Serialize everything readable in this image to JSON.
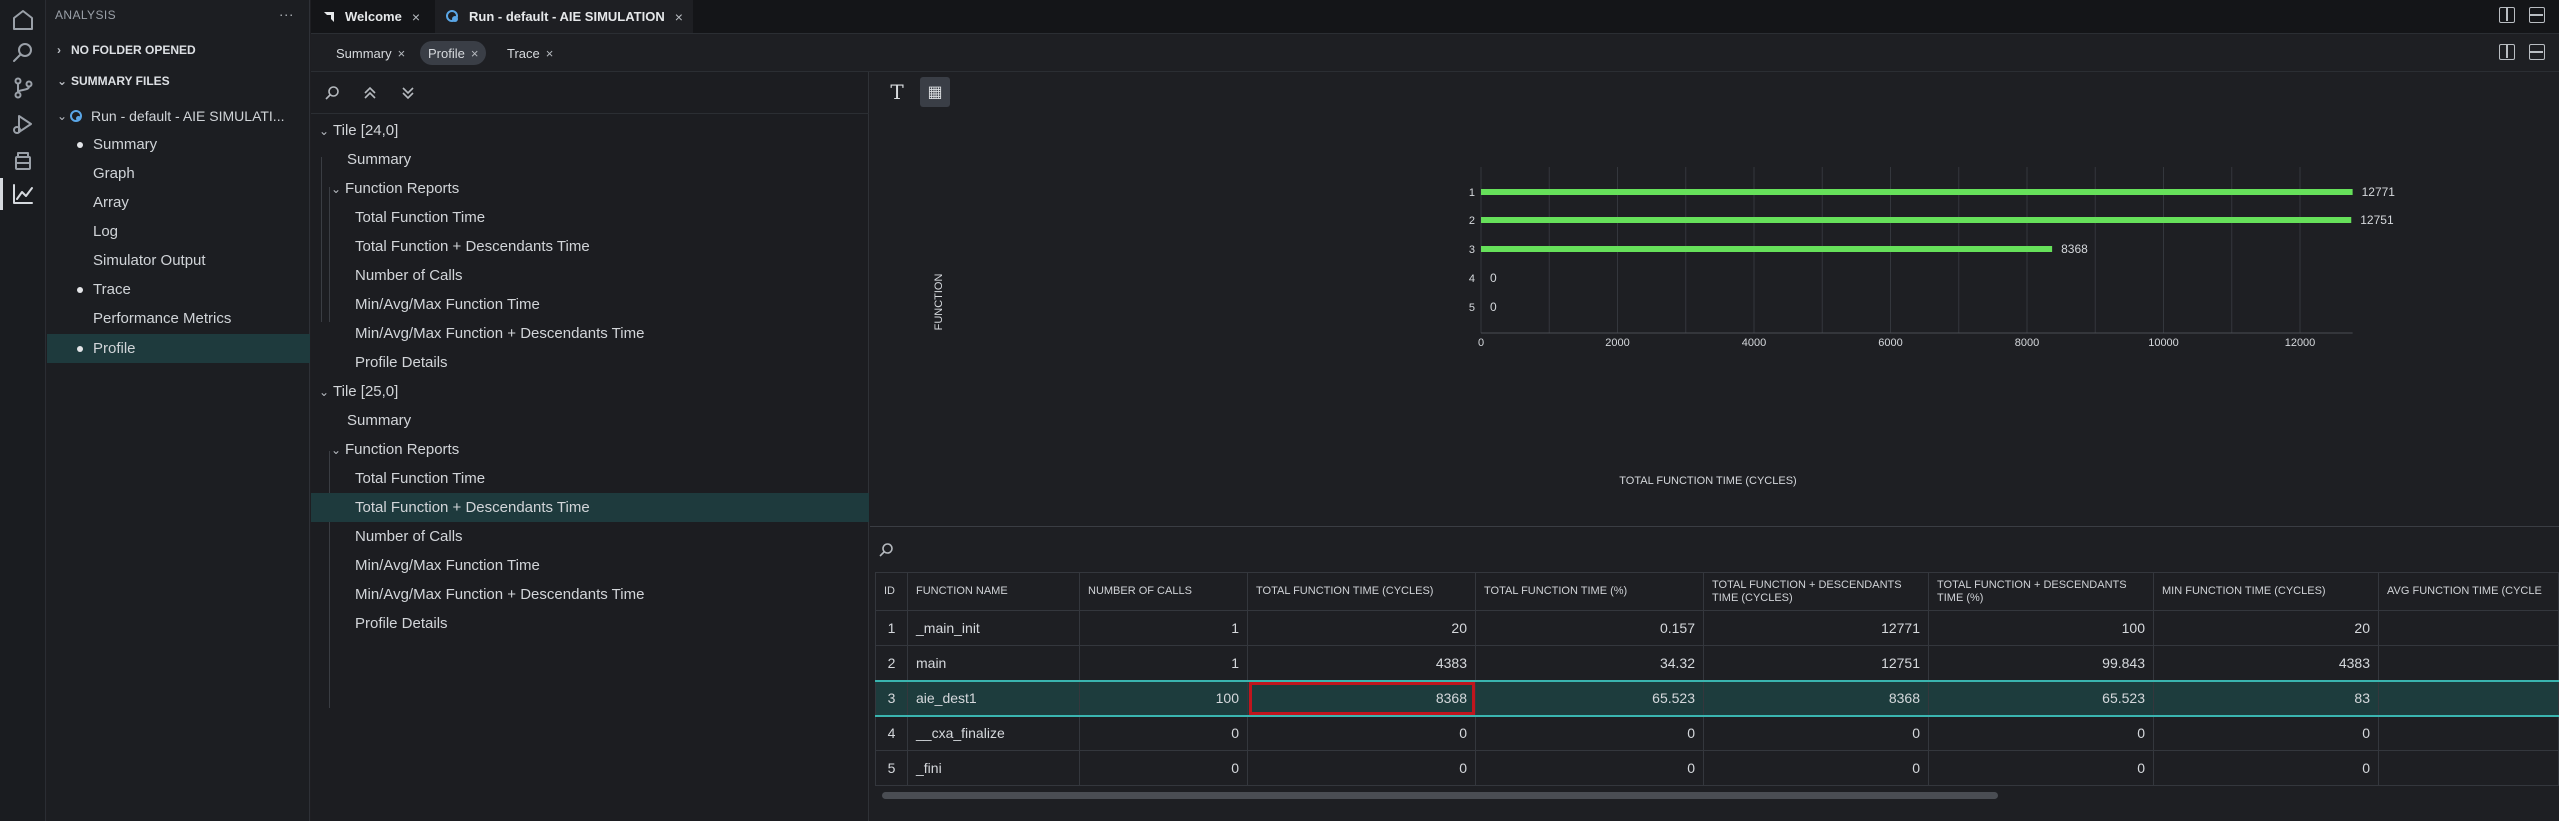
{
  "sidebar": {
    "title": "ANALYSIS",
    "more": "···",
    "no_folder": "NO FOLDER OPENED",
    "summary_files": "SUMMARY FILES",
    "run_label": "Run - default - AIE SIMULATI...",
    "items": [
      {
        "label": "Summary",
        "bullet": true
      },
      {
        "label": "Graph",
        "bullet": false
      },
      {
        "label": "Array",
        "bullet": false
      },
      {
        "label": "Log",
        "bullet": false
      },
      {
        "label": "Simulator Output",
        "bullet": false
      },
      {
        "label": "Trace",
        "bullet": true
      },
      {
        "label": "Performance Metrics",
        "bullet": false
      },
      {
        "label": "Profile",
        "bullet": true
      }
    ]
  },
  "tabs": {
    "welcome": "Welcome",
    "run": "Run - default - AIE SIMULATION",
    "close": "×"
  },
  "subtabs": {
    "summary": "Summary",
    "profile": "Profile",
    "trace": "Trace",
    "close": "×"
  },
  "tree": {
    "tile1": "Tile [24,0]",
    "tile2": "Tile [25,0]",
    "summary": "Summary",
    "function_reports": "Function Reports",
    "reports": [
      "Total Function Time",
      "Total Function + Descendants Time",
      "Number of Calls",
      "Min/Avg/Max Function Time",
      "Min/Avg/Max Function + Descendants Time",
      "Profile Details"
    ]
  },
  "chart_tools": {
    "text": "T",
    "table": "▦"
  },
  "chart_data": {
    "type": "bar",
    "orientation": "horizontal",
    "categories": [
      "1",
      "2",
      "3",
      "4",
      "5"
    ],
    "values": [
      12771,
      12751,
      8368,
      0,
      0
    ],
    "xlabel": "TOTAL FUNCTION TIME (CYCLES)",
    "ylabel": "FUNCTION",
    "xlim": [
      0,
      12771
    ],
    "xticks": [
      "0",
      "2000",
      "4000",
      "6000",
      "8000",
      "10000",
      "12000"
    ],
    "xtick_values": [
      0,
      2000,
      4000,
      6000,
      8000,
      10000,
      12000
    ],
    "color": "#66e05a",
    "grid": true
  },
  "table": {
    "headers": [
      "ID",
      "FUNCTION NAME",
      "NUMBER OF CALLS",
      "TOTAL FUNCTION TIME (CYCLES)",
      "TOTAL FUNCTION TIME (%)",
      "TOTAL FUNCTION + DESCENDANTS TIME (CYCLES)",
      "TOTAL FUNCTION + DESCENDANTS TIME (%)",
      "MIN FUNCTION TIME (CYCLES)",
      "AVG FUNCTION TIME (CYCLE"
    ],
    "rows": [
      [
        "1",
        "_main_init",
        "1",
        "20",
        "0.157",
        "12771",
        "100",
        "20",
        ""
      ],
      [
        "2",
        "main",
        "1",
        "4383",
        "34.32",
        "12751",
        "99.843",
        "4383",
        ""
      ],
      [
        "3",
        "aie_dest1",
        "100",
        "8368",
        "65.523",
        "8368",
        "65.523",
        "83",
        ""
      ],
      [
        "4",
        "__cxa_finalize",
        "0",
        "0",
        "0",
        "0",
        "0",
        "0",
        ""
      ],
      [
        "5",
        "_fini",
        "0",
        "0",
        "0",
        "0",
        "0",
        "0",
        ""
      ]
    ],
    "highlight_row": 2
  }
}
